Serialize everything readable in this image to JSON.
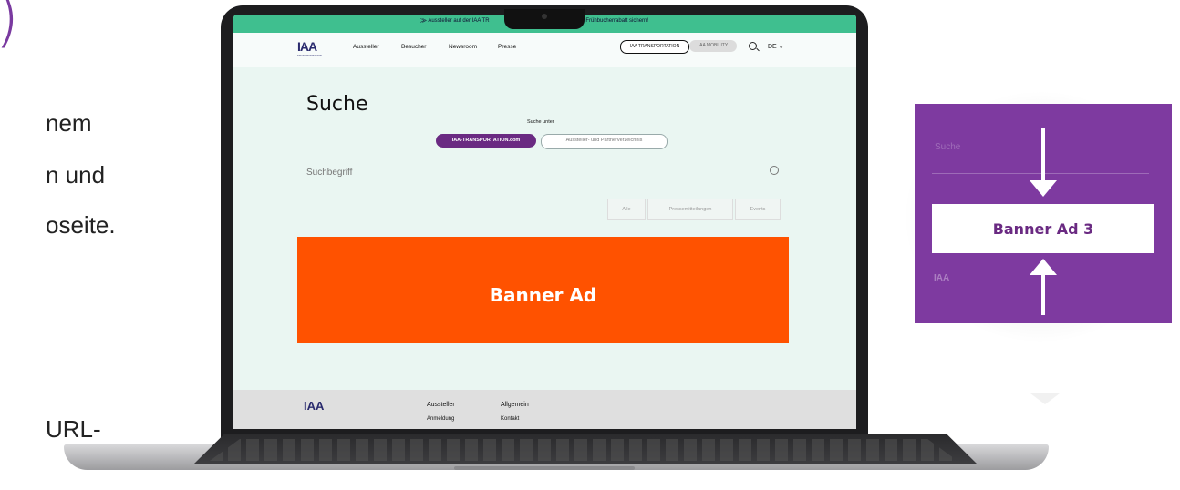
{
  "slide": {
    "paren": ")",
    "lines": [
      "nem",
      "n und",
      "oseite.",
      "URL-"
    ]
  },
  "site": {
    "topbar": {
      "text_left": "⨠  Aussteller auf der IAA TR",
      "text_right": "nd Frühbucherrabatt sichern!"
    },
    "logo": "IAA",
    "logo_sub": "TRANSPORTATION",
    "nav": [
      "Aussteller",
      "Besucher",
      "Newsroom",
      "Presse"
    ],
    "pills": [
      "IAA TRANSPORTATION",
      "IAA MOBILITY"
    ],
    "lang": "DE",
    "page_title": "Suche",
    "search_under": "Suche unter",
    "tabs": [
      "IAA-TRANSPORTATION.com",
      "Aussteller- und Partnerverzeichnis"
    ],
    "search_placeholder": "Suchbegriff",
    "filters": [
      "Alle",
      "Pressemitteilungen",
      "Events"
    ],
    "banner": "Banner Ad",
    "footer": {
      "col1": [
        "Aussteller",
        "Anmeldung"
      ],
      "col2": [
        "Allgemein",
        "Kontakt"
      ]
    }
  },
  "panel": {
    "title": "Suche",
    "logo": "IAA",
    "banner": "Banner Ad 3"
  },
  "colors": {
    "accent_green": "#3fbf8f",
    "brand_purple": "#6a2a82",
    "banner_orange": "#ff5200",
    "panel_purple": "#7e3aa0"
  }
}
